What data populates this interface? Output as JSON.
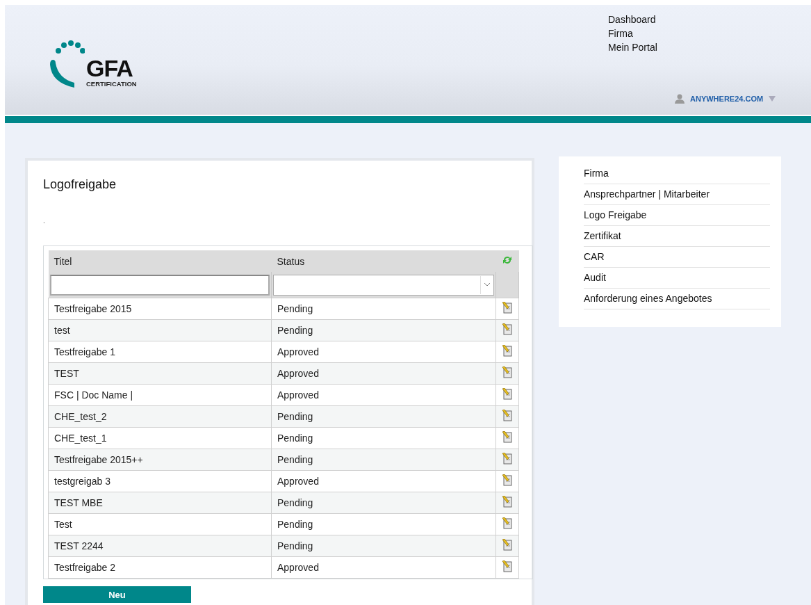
{
  "logo": {
    "name": "GFA",
    "tagline": "CERTIFICATION"
  },
  "top_nav": [
    "Dashboard",
    "Firma",
    "Mein Portal"
  ],
  "user_menu": {
    "label": "ANYWHERE24.COM"
  },
  "main": {
    "title": "Logofreigabe",
    "note": ".",
    "table": {
      "columns": [
        "Titel",
        "Status"
      ],
      "rows": [
        {
          "title": "Testfreigabe 2015",
          "status": "Pending"
        },
        {
          "title": "test",
          "status": "Pending"
        },
        {
          "title": "Testfreigabe 1",
          "status": "Approved"
        },
        {
          "title": "TEST",
          "status": "Approved"
        },
        {
          "title": "FSC | Doc Name |",
          "status": "Approved"
        },
        {
          "title": "CHE_test_2",
          "status": "Pending"
        },
        {
          "title": "CHE_test_1",
          "status": "Pending"
        },
        {
          "title": "Testfreigabe 2015++",
          "status": "Pending"
        },
        {
          "title": "testgreigab 3",
          "status": "Approved"
        },
        {
          "title": "TEST MBE",
          "status": "Pending"
        },
        {
          "title": "Test",
          "status": "Pending"
        },
        {
          "title": "TEST 2244",
          "status": "Pending"
        },
        {
          "title": "Testfreigabe 2",
          "status": "Approved"
        }
      ]
    },
    "new_button": "Neu"
  },
  "sidebar": {
    "items": [
      "Firma",
      "Ansprechpartner | Mitarbeiter",
      "Logo Freigabe",
      "Zertifikat",
      "CAR",
      "Audit",
      "Anforderung eines Angebotes"
    ]
  }
}
